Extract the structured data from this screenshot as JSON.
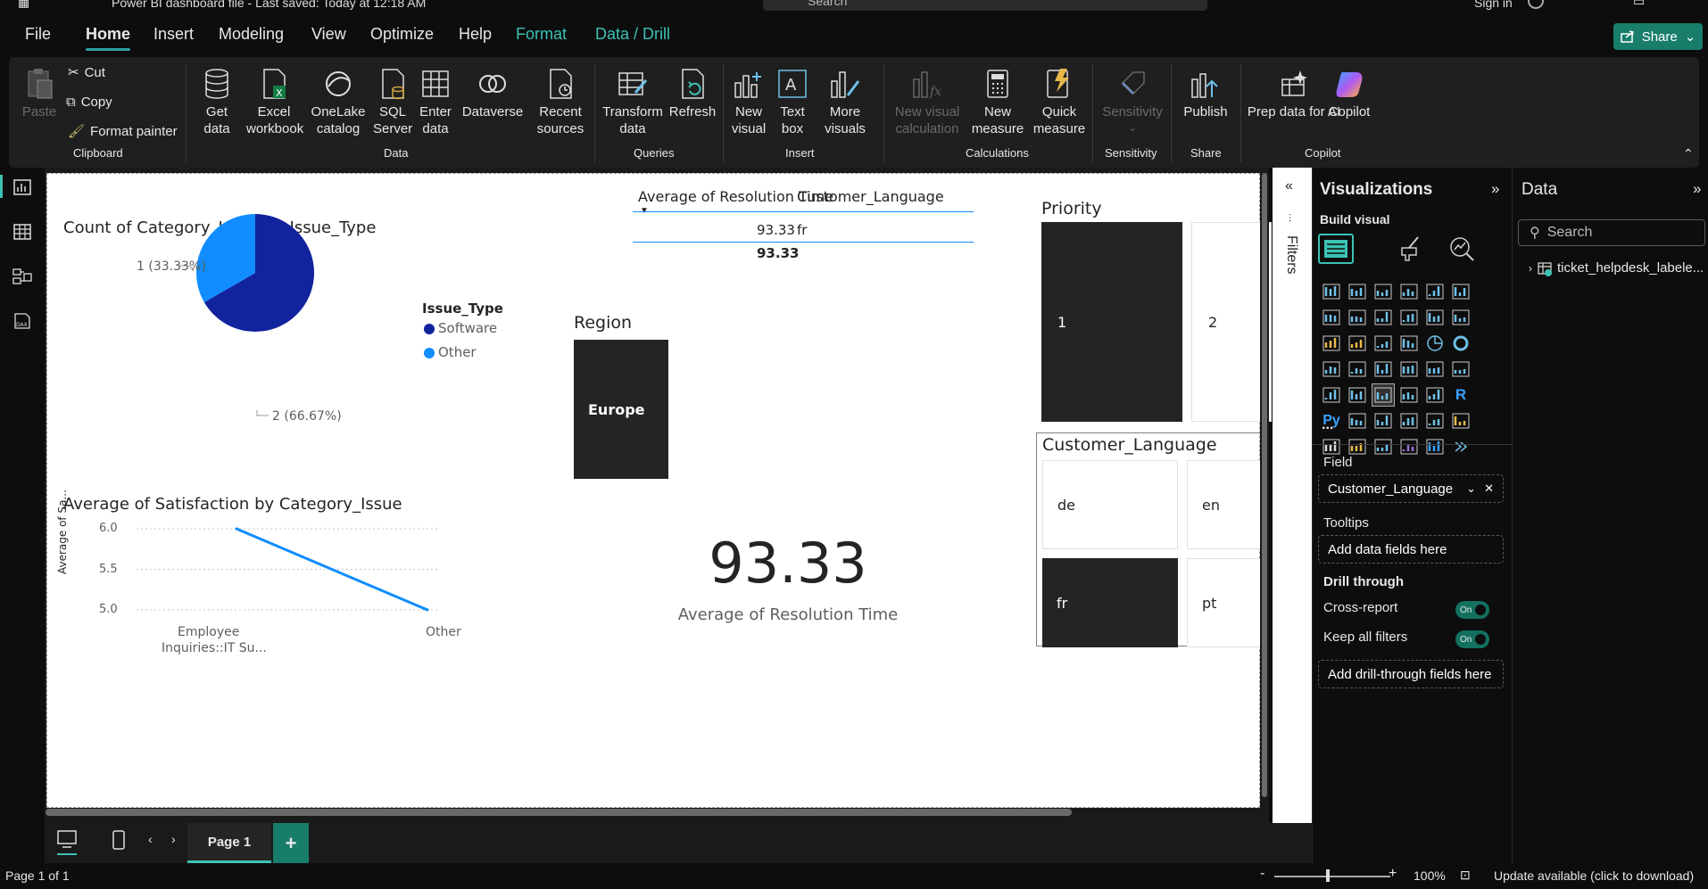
{
  "window": {
    "title": "Power BI dashboard file - Last saved: Today at 12:18 AM",
    "search_placeholder": "Search",
    "signin": "Sign in"
  },
  "menu": {
    "items": [
      "File",
      "Home",
      "Insert",
      "Modeling",
      "View",
      "Optimize",
      "Help",
      "Format",
      "Data / Drill"
    ],
    "active": "Home",
    "share_label": "Share"
  },
  "ribbon": {
    "clipboard": {
      "paste": "Paste",
      "cut": "Cut",
      "copy": "Copy",
      "format_painter": "Format painter",
      "label": "Clipboard"
    },
    "data": {
      "get_data": "Get data",
      "excel": "Excel workbook",
      "onelake": "OneLake catalog",
      "sql": "SQL Server",
      "enter": "Enter data",
      "dataverse": "Dataverse",
      "recent": "Recent sources",
      "label": "Data"
    },
    "queries": {
      "transform": "Transform data",
      "refresh": "Refresh",
      "label": "Queries"
    },
    "insert": {
      "new_visual": "New visual",
      "text_box": "Text box",
      "more_visuals": "More visuals",
      "label": "Insert"
    },
    "calculations": {
      "new_visual_calc": "New visual calculation",
      "new_measure": "New measure",
      "quick_measure": "Quick measure",
      "label": "Calculations"
    },
    "sensitivity": {
      "sensitivity": "Sensitivity",
      "label": "Sensitivity"
    },
    "share": {
      "publish": "Publish",
      "label": "Share"
    },
    "copilot": {
      "prep": "Prep data for AI",
      "copilot": "Copilot",
      "label": "Copilot"
    }
  },
  "pie": {
    "title": "Count of Category_Issue  by Issue_Type",
    "legend_title": "Issue_Type",
    "legend": [
      "Software",
      "Other"
    ],
    "label1": "1 (33.33%)",
    "label2": "2 (66.67%)"
  },
  "chart_data": [
    {
      "type": "pie",
      "title": "Count of Category_Issue  by Issue_Type",
      "categories": [
        "Software",
        "Other"
      ],
      "values": [
        2,
        1
      ],
      "labels": [
        "2 (66.67%)",
        "1 (33.33%)"
      ],
      "colors": [
        "#12239E",
        "#118DFF"
      ]
    },
    {
      "type": "line",
      "title": "Average of Satisfaction by Category_Issue",
      "categories": [
        "Employee Inquiries::IT Su...",
        "Other"
      ],
      "values": [
        6.0,
        5.0
      ],
      "ylabel": "Average of Sa...",
      "yticks": [
        "6.0",
        "5.5",
        "5.0"
      ],
      "ylim": [
        5.0,
        6.0
      ]
    }
  ],
  "table": {
    "col1": "Average of Resolution Time",
    "col2": "Customer_Language",
    "row_val": "93.33",
    "row_lang": "fr",
    "total": "93.33"
  },
  "region": {
    "title": "Region",
    "item": "Europe"
  },
  "priority": {
    "title": "Priority",
    "items": [
      "1",
      "2"
    ]
  },
  "language": {
    "title": "Customer_Language",
    "items": [
      "de",
      "en",
      "fr",
      "pt"
    ]
  },
  "line": {
    "title": "Average of Satisfaction by Category_Issue",
    "ylabel": "Average of Sa...",
    "yticks": [
      "6.0",
      "5.5",
      "5.0"
    ],
    "x1a": "Employee",
    "x1b": "Inquiries::IT Su...",
    "x2": "Other"
  },
  "card": {
    "value": "93.33",
    "label": "Average of Resolution Time"
  },
  "filters": {
    "label": "Filters"
  },
  "viz": {
    "title": "Visualizations",
    "build": "Build visual",
    "more": "...",
    "field_label": "Field",
    "field_value": "Customer_Language",
    "tooltips": "Tooltips",
    "add_data": "Add data fields here",
    "drill": "Drill through",
    "cross": "Cross-report",
    "keep": "Keep all filters",
    "on": "On",
    "add_drill": "Add drill-through fields here"
  },
  "data": {
    "title": "Data",
    "search": "Search",
    "table": "ticket_helpdesk_labele..."
  },
  "pages": {
    "page1": "Page 1"
  },
  "status": {
    "page": "Page 1 of 1",
    "zoom": "100%",
    "update": "Update available (click to download)"
  }
}
